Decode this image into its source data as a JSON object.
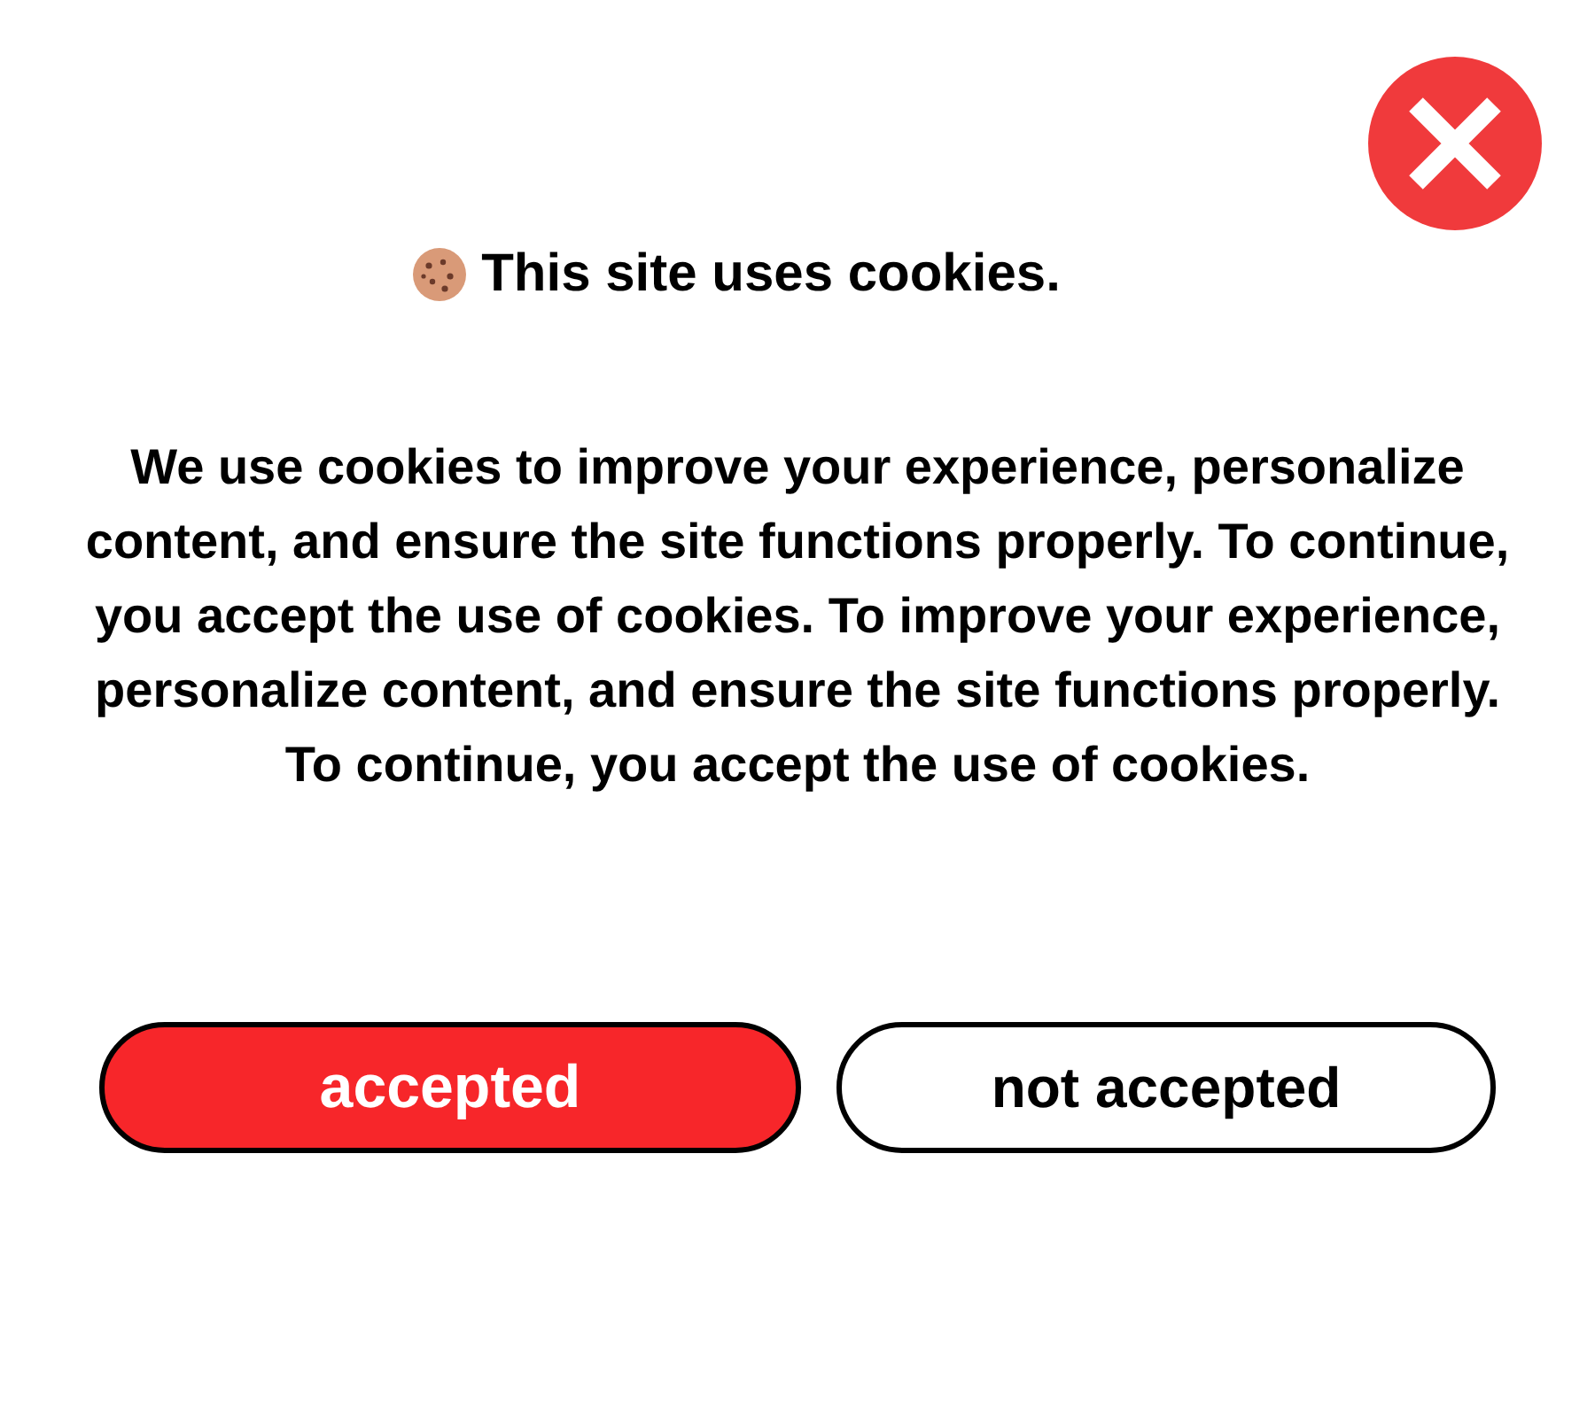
{
  "dialog": {
    "title": "This site uses cookies.",
    "message": "We use cookies to improve your experience, personalize content, and ensure the site functions properly. To continue, you accept the use of cookies. To improve your experience, personalize content, and ensure the site functions properly. To continue, you accept the use of cookies.",
    "buttons": [
      {
        "label": "accepted",
        "kind": "primary"
      },
      {
        "label": "not accepted",
        "kind": "secondary"
      }
    ]
  }
}
